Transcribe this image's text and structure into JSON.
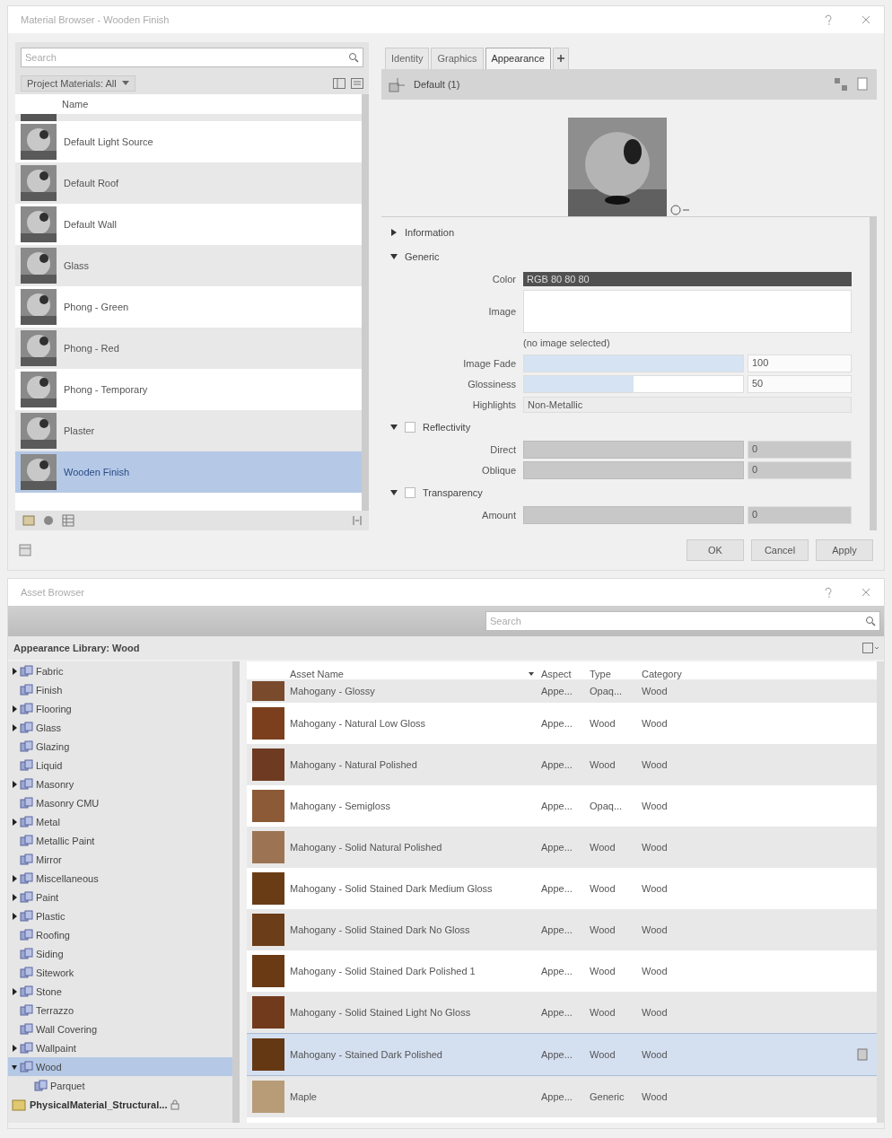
{
  "material_browser": {
    "title": "Material Browser - Wooden Finish",
    "search": {
      "placeholder": "Search"
    },
    "filter": "Project Materials: All",
    "column": "Name",
    "materials": [
      {
        "name": "Default Light Source",
        "selected": false
      },
      {
        "name": "Default Roof",
        "selected": false
      },
      {
        "name": "Default Wall",
        "selected": false
      },
      {
        "name": "Glass",
        "selected": false
      },
      {
        "name": "Phong - Green",
        "selected": false
      },
      {
        "name": "Phong - Red",
        "selected": false
      },
      {
        "name": "Phong - Temporary",
        "selected": false
      },
      {
        "name": "Plaster",
        "selected": false
      },
      {
        "name": "Wooden Finish",
        "selected": true
      }
    ],
    "tabs": [
      {
        "label": "Identity",
        "selected": false
      },
      {
        "label": "Graphics",
        "selected": false
      },
      {
        "label": "Appearance",
        "selected": true
      }
    ],
    "asset_name": "Default (1)",
    "sections": [
      {
        "title": "Information",
        "expanded": false
      },
      {
        "title": "Generic",
        "expanded": true,
        "fields": [
          {
            "kind": "swatch",
            "label": "Color",
            "value": "RGB 80 80 80"
          },
          {
            "kind": "image",
            "label": "Image",
            "caption": "(no image selected)"
          },
          {
            "kind": "slider",
            "label": "Image Fade",
            "level": 1,
            "value": "100",
            "disabled": false
          },
          {
            "kind": "slider",
            "label": "Glossiness",
            "level": 0.5,
            "value": "50",
            "disabled": false
          },
          {
            "kind": "select",
            "label": "Highlights",
            "value": "Non-Metallic"
          }
        ]
      },
      {
        "title": "Reflectivity",
        "expanded": true,
        "checked": false,
        "fields": [
          {
            "kind": "slider",
            "label": "Direct",
            "level": 0,
            "value": "0",
            "disabled": true
          },
          {
            "kind": "slider",
            "label": "Oblique",
            "level": 0,
            "value": "0",
            "disabled": true
          }
        ]
      },
      {
        "title": "Transparency",
        "expanded": true,
        "checked": false,
        "fields": [
          {
            "kind": "slider",
            "label": "Amount",
            "level": 0,
            "value": "0",
            "disabled": true
          }
        ]
      }
    ],
    "buttons": [
      "OK",
      "Cancel",
      "Apply"
    ]
  },
  "asset_browser": {
    "title": "Asset Browser",
    "search": {
      "placeholder": "Search"
    },
    "library": "Appearance Library: Wood",
    "tree": [
      {
        "label": "Fabric",
        "expanded": false,
        "selected": false
      },
      {
        "label": "Finish",
        "selected": false
      },
      {
        "label": "Flooring",
        "expanded": false,
        "selected": false
      },
      {
        "label": "Glass",
        "expanded": false,
        "selected": false
      },
      {
        "label": "Glazing",
        "selected": false
      },
      {
        "label": "Liquid",
        "selected": false
      },
      {
        "label": "Masonry",
        "expanded": false,
        "selected": false
      },
      {
        "label": "Masonry CMU",
        "selected": false
      },
      {
        "label": "Metal",
        "expanded": false,
        "selected": false
      },
      {
        "label": "Metallic Paint",
        "selected": false
      },
      {
        "label": "Mirror",
        "selected": false
      },
      {
        "label": "Miscellaneous",
        "expanded": false,
        "selected": false
      },
      {
        "label": "Paint",
        "expanded": false,
        "selected": false
      },
      {
        "label": "Plastic",
        "expanded": false,
        "selected": false
      },
      {
        "label": "Roofing",
        "selected": false
      },
      {
        "label": "Siding",
        "selected": false
      },
      {
        "label": "Sitework",
        "selected": false
      },
      {
        "label": "Stone",
        "expanded": false,
        "selected": false
      },
      {
        "label": "Terrazzo",
        "selected": false
      },
      {
        "label": "Wall Covering",
        "selected": false
      },
      {
        "label": "Wallpaint",
        "expanded": false,
        "selected": false
      },
      {
        "label": "Wood",
        "expanded": true,
        "selected": true,
        "children": [
          {
            "label": "Parquet",
            "selected": false
          }
        ]
      }
    ],
    "other_library": "PhysicalMaterial_Structural...",
    "columns": [
      "Asset Name",
      "Aspect",
      "Type",
      "Category"
    ],
    "rows": [
      {
        "name": "Mahogany - Glossy",
        "aspect": "Appe...",
        "type": "Opaq...",
        "category": "Wood",
        "color": "#7a4a2c",
        "selected": false
      },
      {
        "name": "Mahogany - Natural Low Gloss",
        "aspect": "Appe...",
        "type": "Wood",
        "category": "Wood",
        "color": "#7b3f1e",
        "selected": false
      },
      {
        "name": "Mahogany - Natural Polished",
        "aspect": "Appe...",
        "type": "Wood",
        "category": "Wood",
        "color": "#6e3a22",
        "selected": false
      },
      {
        "name": "Mahogany - Semigloss",
        "aspect": "Appe...",
        "type": "Opaq...",
        "category": "Wood",
        "color": "#8c5a36",
        "selected": false
      },
      {
        "name": "Mahogany - Solid Natural Polished",
        "aspect": "Appe...",
        "type": "Wood",
        "category": "Wood",
        "color": "#9c7454",
        "selected": false
      },
      {
        "name": "Mahogany - Solid Stained Dark Medium Gloss",
        "aspect": "Appe...",
        "type": "Wood",
        "category": "Wood",
        "color": "#6a3c16",
        "selected": false
      },
      {
        "name": "Mahogany - Solid Stained Dark No Gloss",
        "aspect": "Appe...",
        "type": "Wood",
        "category": "Wood",
        "color": "#6b3d18",
        "selected": false
      },
      {
        "name": "Mahogany - Solid Stained Dark Polished 1",
        "aspect": "Appe...",
        "type": "Wood",
        "category": "Wood",
        "color": "#6a3a14",
        "selected": false
      },
      {
        "name": "Mahogany - Solid Stained Light No Gloss",
        "aspect": "Appe...",
        "type": "Wood",
        "category": "Wood",
        "color": "#723a1c",
        "selected": false
      },
      {
        "name": "Mahogany - Stained Dark Polished",
        "aspect": "Appe...",
        "type": "Wood",
        "category": "Wood",
        "color": "#653814",
        "selected": true
      },
      {
        "name": "Maple",
        "aspect": "Appe...",
        "type": "Generic",
        "category": "Wood",
        "color": "#b89c78",
        "selected": false
      }
    ]
  }
}
